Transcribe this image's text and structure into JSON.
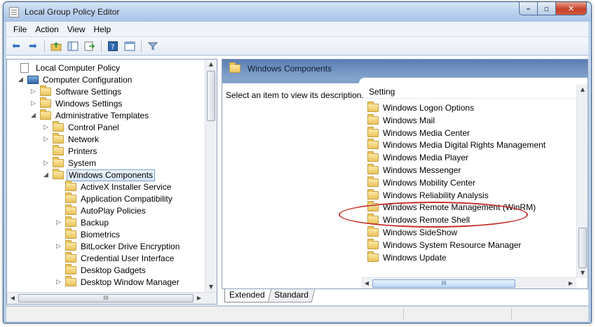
{
  "window": {
    "title": "Local Group Policy Editor"
  },
  "caption_buttons": {
    "minimize": "–",
    "maximize": "▫",
    "close": "✕"
  },
  "menu": [
    "File",
    "Action",
    "View",
    "Help"
  ],
  "toolbar": {
    "icons": [
      "back-icon",
      "forward-icon",
      "up-folder-icon",
      "show-hide-console-tree-icon",
      "export-list-icon",
      "help-icon",
      "properties-icon",
      "filter-icon"
    ]
  },
  "tree": {
    "nodes": [
      {
        "label": "Local Computer Policy",
        "level": 0,
        "expander": "",
        "icon": "policy-icon"
      },
      {
        "label": "Computer Configuration",
        "level": 1,
        "expander": "◢",
        "icon": "computer-icon"
      },
      {
        "label": "Software Settings",
        "level": 2,
        "expander": "▷",
        "icon": "folder-icon"
      },
      {
        "label": "Windows Settings",
        "level": 2,
        "expander": "▷",
        "icon": "folder-icon"
      },
      {
        "label": "Administrative Templates",
        "level": 2,
        "expander": "◢",
        "icon": "folder-icon"
      },
      {
        "label": "Control Panel",
        "level": 3,
        "expander": "▷",
        "icon": "folder-icon"
      },
      {
        "label": "Network",
        "level": 3,
        "expander": "▷",
        "icon": "folder-icon"
      },
      {
        "label": "Printers",
        "level": 3,
        "expander": "",
        "icon": "folder-icon"
      },
      {
        "label": "System",
        "level": 3,
        "expander": "▷",
        "icon": "folder-icon"
      },
      {
        "label": "Windows Components",
        "level": 3,
        "expander": "◢",
        "icon": "folder-icon",
        "selected": true
      },
      {
        "label": "ActiveX Installer Service",
        "level": 4,
        "expander": "",
        "icon": "folder-icon"
      },
      {
        "label": "Application Compatibility",
        "level": 4,
        "expander": "",
        "icon": "folder-icon"
      },
      {
        "label": "AutoPlay Policies",
        "level": 4,
        "expander": "",
        "icon": "folder-icon"
      },
      {
        "label": "Backup",
        "level": 4,
        "expander": "▷",
        "icon": "folder-icon"
      },
      {
        "label": "Biometrics",
        "level": 4,
        "expander": "",
        "icon": "folder-icon"
      },
      {
        "label": "BitLocker Drive Encryption",
        "level": 4,
        "expander": "▷",
        "icon": "folder-icon"
      },
      {
        "label": "Credential User Interface",
        "level": 4,
        "expander": "",
        "icon": "folder-icon"
      },
      {
        "label": "Desktop Gadgets",
        "level": 4,
        "expander": "",
        "icon": "folder-icon"
      },
      {
        "label": "Desktop Window Manager",
        "level": 4,
        "expander": "▷",
        "icon": "folder-icon"
      }
    ],
    "scroll_glyph": "III"
  },
  "detail": {
    "header_title": "Windows Components",
    "description": "Select an item to view its description.",
    "column_header": "Setting",
    "settings": [
      "Windows Logon Options",
      "Windows Mail",
      "Windows Media Center",
      "Windows Media Digital Rights Management",
      "Windows Media Player",
      "Windows Messenger",
      "Windows Mobility Center",
      "Windows Reliability Analysis",
      "Windows Remote Management (WinRM)",
      "Windows Remote Shell",
      "Windows SideShow",
      "Windows System Resource Manager",
      "Windows Update"
    ],
    "scroll_glyph": "III"
  },
  "tabs": [
    "Extended",
    "Standard"
  ],
  "colors": {
    "header_blue": "#5b7fb3",
    "annotation_red": "#c4302b",
    "close_red": "#c7412a"
  }
}
